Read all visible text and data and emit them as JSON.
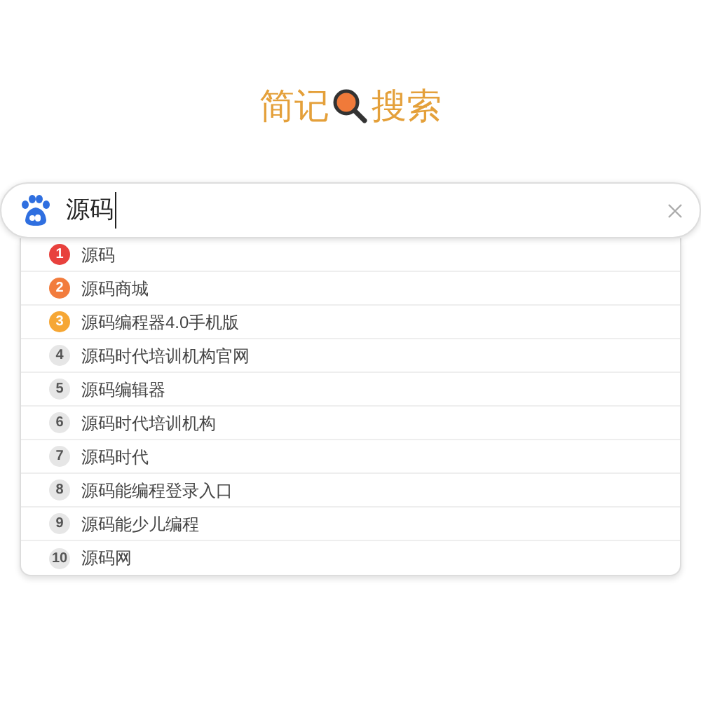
{
  "logo": {
    "left": "简记",
    "right": "搜索"
  },
  "search": {
    "value": "源码"
  },
  "suggestions": [
    {
      "rank": "1",
      "text": "源码",
      "color": "#e8413d"
    },
    {
      "rank": "2",
      "text": "源码商城",
      "color": "#f27c3d"
    },
    {
      "rank": "3",
      "text": "源码编程器4.0手机版",
      "color": "#f6a735"
    },
    {
      "rank": "4",
      "text": "源码时代培训机构官网",
      "color": "#e6e6e6"
    },
    {
      "rank": "5",
      "text": "源码编辑器",
      "color": "#e6e6e6"
    },
    {
      "rank": "6",
      "text": "源码时代培训机构",
      "color": "#e6e6e6"
    },
    {
      "rank": "7",
      "text": "源码时代",
      "color": "#e6e6e6"
    },
    {
      "rank": "8",
      "text": "源码能编程登录入口",
      "color": "#e6e6e6"
    },
    {
      "rank": "9",
      "text": "源码能少儿编程",
      "color": "#e6e6e6"
    },
    {
      "rank": "10",
      "text": "源码网",
      "color": "#e6e6e6"
    }
  ]
}
